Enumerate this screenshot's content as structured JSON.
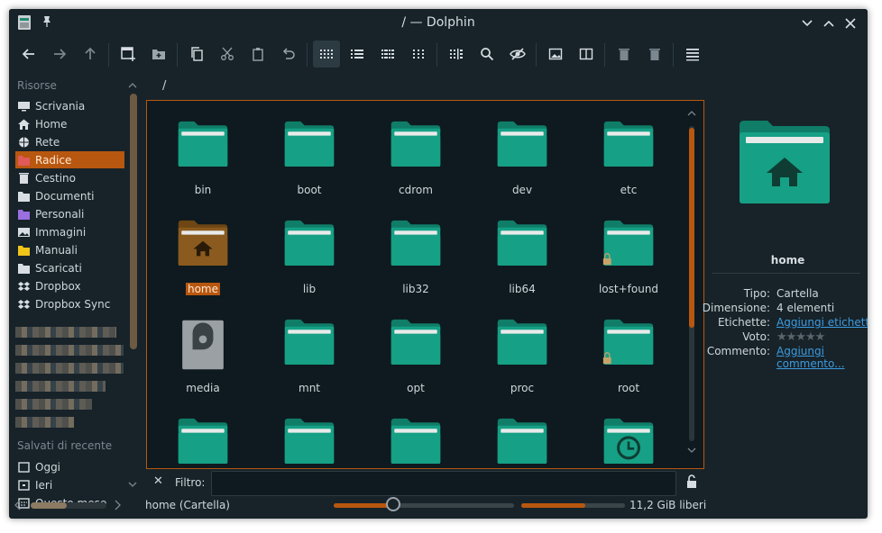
{
  "window": {
    "title": "/ — Dolphin"
  },
  "toolbar": {
    "buttons": [
      "back",
      "forward",
      "up",
      "new-window",
      "new-folder",
      "copy",
      "cut",
      "paste",
      "undo",
      "icons-view",
      "details-view",
      "compact-view",
      "small-icons-view",
      "split-view-toggle",
      "search",
      "hidden-files",
      "preview",
      "split",
      "trash",
      "delete",
      "menu"
    ]
  },
  "sidebar": {
    "places_heading": "Risorse",
    "places": [
      {
        "label": "Scrivania",
        "icon": "desktop-icon"
      },
      {
        "label": "Home",
        "icon": "home-icon"
      },
      {
        "label": "Rete",
        "icon": "network-icon"
      },
      {
        "label": "Radice",
        "icon": "root-folder-icon",
        "selected": true
      },
      {
        "label": "Cestino",
        "icon": "trash-icon"
      },
      {
        "label": "Documenti",
        "icon": "documents-icon"
      },
      {
        "label": "Personali",
        "icon": "personal-icon"
      },
      {
        "label": "Immagini",
        "icon": "images-icon"
      },
      {
        "label": "Manuali",
        "icon": "manuals-icon"
      },
      {
        "label": "Scaricati",
        "icon": "downloads-icon"
      },
      {
        "label": "Dropbox",
        "icon": "dropbox-icon"
      },
      {
        "label": "Dropbox Sync",
        "icon": "dropbox-icon"
      }
    ],
    "recent_heading": "Salvati di recente",
    "recent": [
      {
        "label": "Oggi",
        "icon": "today-icon"
      },
      {
        "label": "Ieri",
        "icon": "yesterday-icon"
      },
      {
        "label": "Questo mese",
        "icon": "calendar-icon"
      }
    ]
  },
  "breadcrumb": "/",
  "files": [
    {
      "label": "bin",
      "kind": "folder"
    },
    {
      "label": "boot",
      "kind": "folder"
    },
    {
      "label": "cdrom",
      "kind": "folder"
    },
    {
      "label": "dev",
      "kind": "folder"
    },
    {
      "label": "etc",
      "kind": "folder"
    },
    {
      "label": "home",
      "kind": "home",
      "selected": true
    },
    {
      "label": "lib",
      "kind": "folder"
    },
    {
      "label": "lib32",
      "kind": "folder"
    },
    {
      "label": "lib64",
      "kind": "folder"
    },
    {
      "label": "lost+found",
      "kind": "locked"
    },
    {
      "label": "media",
      "kind": "drive"
    },
    {
      "label": "mnt",
      "kind": "folder"
    },
    {
      "label": "opt",
      "kind": "folder"
    },
    {
      "label": "proc",
      "kind": "folder"
    },
    {
      "label": "root",
      "kind": "locked"
    },
    {
      "label": "",
      "kind": "folder"
    },
    {
      "label": "",
      "kind": "folder"
    },
    {
      "label": "",
      "kind": "folder"
    },
    {
      "label": "",
      "kind": "folder"
    },
    {
      "label": "",
      "kind": "clock"
    }
  ],
  "filter": {
    "label": "Filtro:",
    "value": ""
  },
  "status": {
    "text": "home (Cartella)",
    "free_space": "11,2 GiB liberi",
    "zoom_level": 0.33,
    "used_fraction": 0.62
  },
  "info_panel": {
    "name": "home",
    "rows": [
      {
        "key": "Tipo:",
        "value": "Cartella"
      },
      {
        "key": "Dimensione:",
        "value": "4 elementi"
      },
      {
        "key": "Etichette:",
        "value": "Aggiungi etichette",
        "link": true
      },
      {
        "key": "Voto:",
        "value": "",
        "stars": 0
      },
      {
        "key": "Commento:",
        "value": "Aggiungi commento...",
        "link": true
      }
    ]
  },
  "colors": {
    "accent": "#b8570f",
    "folder": "#16a085",
    "folder_tab": "#0f7d68",
    "background": "#172329",
    "view_bg": "#0e1a1f",
    "link": "#3d9be0"
  }
}
